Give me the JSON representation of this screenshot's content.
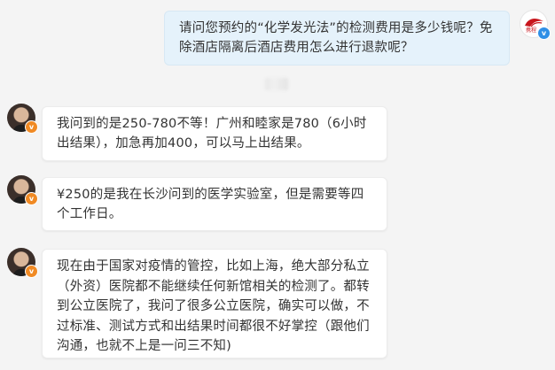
{
  "messages": [
    {
      "side": "right",
      "text": "请问您预约的“化学发光法”的检测费用是多少钱呢？免除酒店隔离后酒店费用怎么进行退款呢？"
    },
    {
      "side": "left",
      "text": "我问到的是250-780不等！广州和睦家是780（6小时出结果），加急再加400，可以马上出结果。"
    },
    {
      "side": "left",
      "text": "¥250的是我在长沙问到的医学实验室，但是需要等四个工作日。"
    },
    {
      "side": "left",
      "text": "现在由于国家对疫情的管控，比如上海，绝大部分私立（外资）医院都不能继续任何新馆相关的检测了。都转到公立医院了，我问了很多公立医院，确实可以做，不过标准、测试方式和出结果时间都很不好掌控（跟他们沟通，也就不上是一问三不知)"
    }
  ],
  "avatars": {
    "right_badge": "v",
    "left_badge": "v",
    "right_logo_text": "携程"
  },
  "colors": {
    "background": "#f4f4f4",
    "right_bubble": "#e5f2fb",
    "left_bubble": "#ffffff",
    "left_badge": "#f08a24",
    "right_badge": "#2f8fe6"
  }
}
